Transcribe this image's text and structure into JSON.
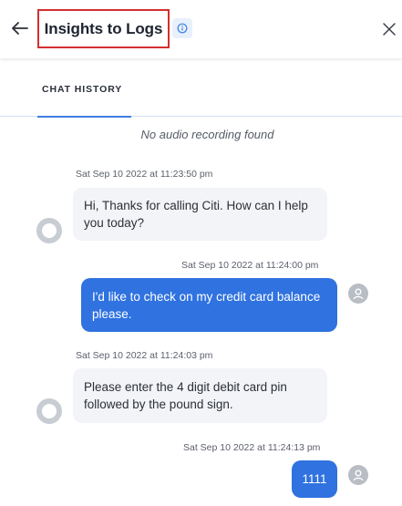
{
  "header": {
    "title": "Insights to Logs",
    "back_icon": "arrow-left-icon",
    "info_icon": "info-icon",
    "close_icon": "close-icon"
  },
  "tabs": [
    {
      "label": "CHAT HISTORY",
      "active": true
    }
  ],
  "notice": "No audio recording found",
  "messages": [
    {
      "sender": "bot",
      "timestamp": "Sat Sep 10 2022 at 11:23:50 pm",
      "text": "Hi, Thanks for calling Citi. How can I help you today?"
    },
    {
      "sender": "user",
      "timestamp": "Sat Sep 10 2022 at 11:24:00 pm",
      "text": "I'd like to check on my credit card balance please."
    },
    {
      "sender": "bot",
      "timestamp": "Sat Sep 10 2022 at 11:24:03 pm",
      "text": "Please enter the 4 digit debit card pin followed by the pound sign."
    },
    {
      "sender": "user",
      "timestamp": "Sat Sep 10 2022 at 11:24:13 pm",
      "text": "1111"
    }
  ],
  "colors": {
    "accent": "#2f72e0",
    "highlight_border": "#d32f2f",
    "bot_bubble": "#f3f4f7"
  }
}
